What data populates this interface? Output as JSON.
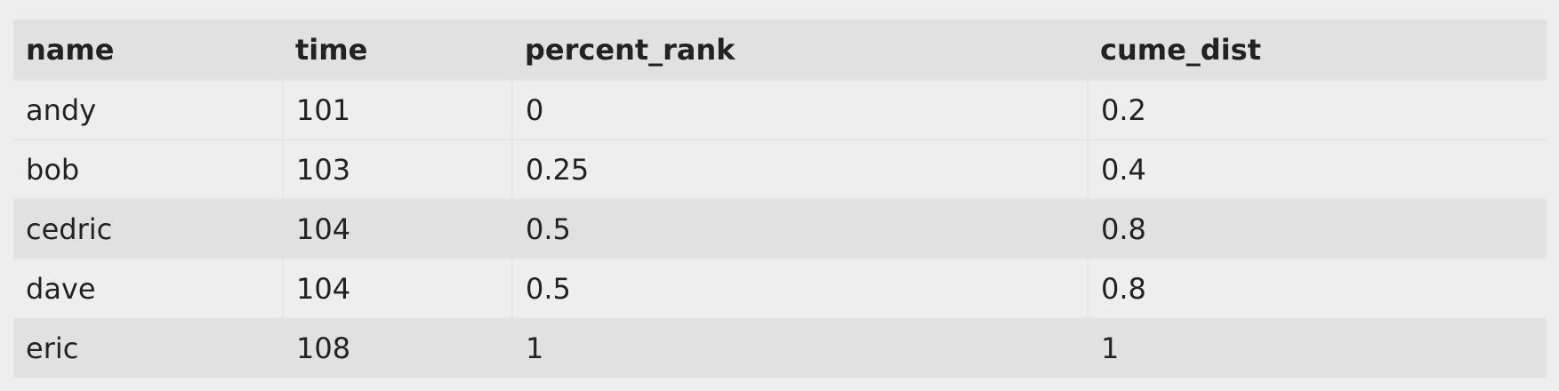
{
  "table": {
    "headers": [
      "name",
      "time",
      "percent_rank",
      "cume_dist"
    ],
    "rows": [
      [
        "andy",
        "101",
        "0",
        "0.2"
      ],
      [
        "bob",
        "103",
        "0.25",
        "0.4"
      ],
      [
        "cedric",
        "104",
        "0.5",
        "0.8"
      ],
      [
        "dave",
        "104",
        "0.5",
        "0.8"
      ],
      [
        "eric",
        "108",
        "1",
        "1"
      ]
    ]
  },
  "colors": {
    "page_background": "#eeeeee",
    "header_background": "#e1e1e1",
    "striped_row_background": "#e1e1e1",
    "text": "#222222"
  }
}
